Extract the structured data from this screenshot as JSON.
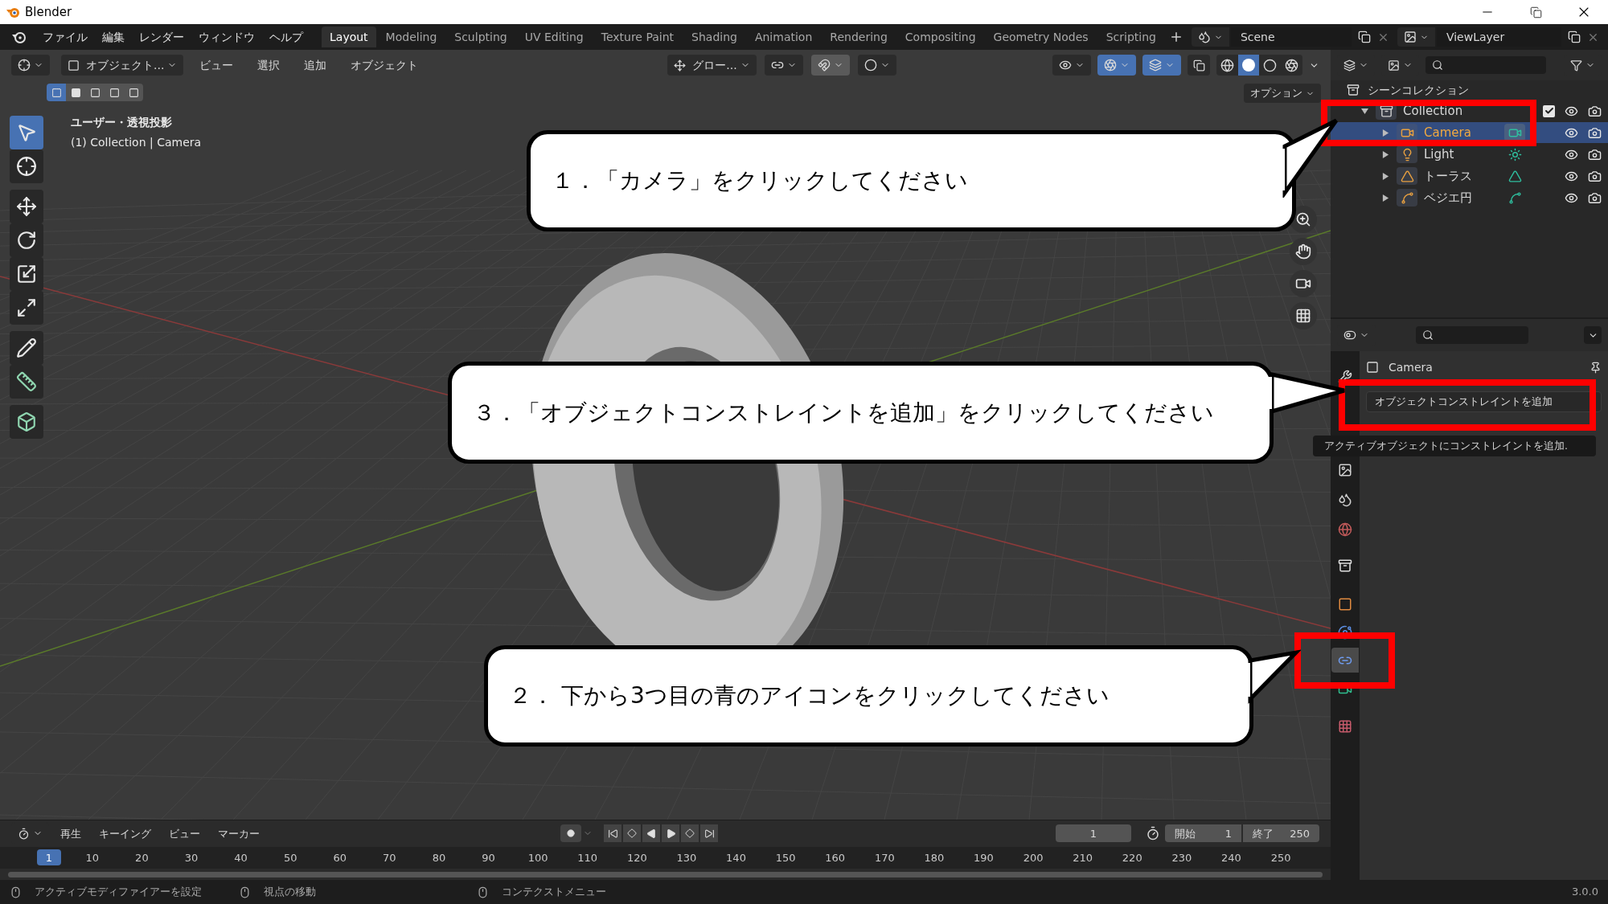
{
  "window": {
    "title": "Blender"
  },
  "menu": [
    "ファイル",
    "編集",
    "レンダー",
    "ウィンドウ",
    "ヘルプ"
  ],
  "workspaces": [
    {
      "label": "Layout",
      "selected": true
    },
    {
      "label": "Modeling",
      "selected": false
    },
    {
      "label": "Sculpting",
      "selected": false
    },
    {
      "label": "UV Editing",
      "selected": false
    },
    {
      "label": "Texture Paint",
      "selected": false
    },
    {
      "label": "Shading",
      "selected": false
    },
    {
      "label": "Animation",
      "selected": false
    },
    {
      "label": "Rendering",
      "selected": false
    },
    {
      "label": "Compositing",
      "selected": false
    },
    {
      "label": "Geometry Nodes",
      "selected": false
    },
    {
      "label": "Scripting",
      "selected": false
    }
  ],
  "scene": "Scene",
  "view_layer": "ViewLayer",
  "viewport": {
    "mode": "オブジェクト...",
    "menus": [
      "ビュー",
      "選択",
      "追加",
      "オブジェクト"
    ],
    "orientation": "グロー...",
    "options": "オプション",
    "view_name": "ユーザー・透視投影",
    "context": "(1) Collection | Camera",
    "toggles": [
      {
        "kind": "snap",
        "on": true
      },
      {
        "kind": "proportional",
        "on": false
      },
      {
        "kind": "gizmo",
        "on": true
      },
      {
        "kind": "overlay",
        "on": true
      }
    ],
    "select_modes": [
      {
        "selected": true
      },
      {
        "selected": false
      },
      {
        "selected": false
      },
      {
        "selected": false
      },
      {
        "selected": false
      }
    ],
    "tools": [
      {
        "kind": "select",
        "selected": true
      },
      {
        "kind": "cursor",
        "selected": false
      },
      {
        "kind": "move",
        "selected": false
      },
      {
        "kind": "rotate",
        "selected": false
      },
      {
        "kind": "scale",
        "selected": false
      },
      {
        "kind": "transform",
        "selected": false
      },
      {
        "kind": "annotate",
        "selected": false
      },
      {
        "kind": "measure",
        "selected": false
      },
      {
        "kind": "add_cube",
        "selected": false
      }
    ]
  },
  "outliner": {
    "root": "シーンコレクション",
    "items": [
      {
        "label": "Collection",
        "kind": "collection",
        "checked": true,
        "expanded": true,
        "selected": false,
        "children": [
          {
            "label": "Camera",
            "kind": "camera",
            "selected": true
          },
          {
            "label": "Light",
            "kind": "light",
            "selected": false
          },
          {
            "label": "トーラス",
            "kind": "mesh",
            "selected": false
          },
          {
            "label": "ベジエ円",
            "kind": "curve",
            "selected": false
          }
        ]
      }
    ]
  },
  "properties": {
    "object_name": "Camera",
    "add_button": "オブジェクトコンストレイントを追加",
    "tooltip": "アクティブオブジェクトにコンストレイントを追加.",
    "tabs": [
      {
        "kind": "tool",
        "selected": false
      },
      {
        "kind": "view_layer",
        "selected": false
      },
      {
        "kind": "scene",
        "selected": false
      },
      {
        "kind": "world",
        "selected": false
      },
      {
        "kind": "collection",
        "selected": false
      },
      {
        "kind": "object",
        "selected": false
      },
      {
        "kind": "physics",
        "selected": false
      },
      {
        "kind": "constraint",
        "selected": true
      },
      {
        "kind": "data",
        "selected": false
      },
      {
        "kind": "texture",
        "selected": false
      }
    ]
  },
  "timeline": {
    "menus": [
      "再生",
      "キーイング",
      "ビュー",
      "マーカー"
    ],
    "current_frame": "1",
    "start_label": "開始",
    "start": "1",
    "end_label": "終了",
    "end": "250",
    "playhead": "1",
    "ruler": [
      "10",
      "20",
      "30",
      "40",
      "50",
      "60",
      "70",
      "80",
      "90",
      "100",
      "110",
      "120",
      "130",
      "140",
      "150",
      "160",
      "170",
      "180",
      "190",
      "200",
      "210",
      "220",
      "230",
      "240",
      "250"
    ]
  },
  "status_bar": {
    "items": [
      "アクティブモディファイアーを設定",
      "視点の移動",
      "コンテクストメニュー"
    ],
    "version": "3.0.0"
  },
  "callouts": [
    {
      "text": "１．「カメラ」をクリックしてください"
    },
    {
      "text": "３．「オブジェクトコンストレイントを追加」をクリックしてください"
    },
    {
      "text": "２． 下から3つ目の青のアイコンをクリックしてください"
    }
  ]
}
